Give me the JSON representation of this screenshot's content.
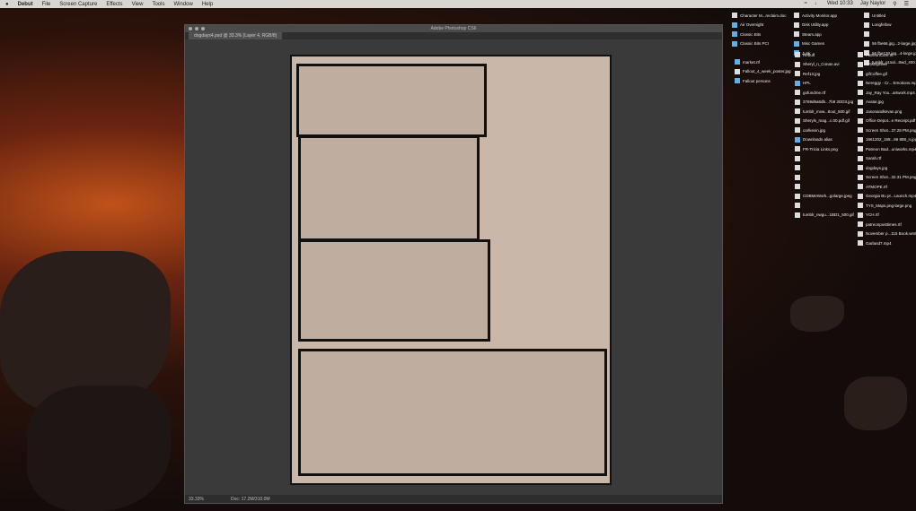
{
  "menubar": {
    "app": "Debut",
    "items": [
      "File",
      "Screen Capture",
      "Effects",
      "View",
      "Tools",
      "Window",
      "Help"
    ],
    "clock": "Wed 10:33",
    "user": "Jay Naylor"
  },
  "window": {
    "title": "Adobe Photoshop CS6",
    "doc_tab": "dogdays4.psd @ 33.3% (Layer 4, RGB/8)",
    "zoom": "33.33%",
    "doc_info": "Doc: 17.2M/310.0M"
  },
  "desktop": {
    "col1": [
      {
        "label": "Character M...reclaim.doc",
        "icon": "file"
      },
      {
        "label": "Air Overnight",
        "icon": "folder"
      },
      {
        "label": "Classic Bits",
        "icon": "folder"
      },
      {
        "label": "Classic Bits PCI",
        "icon": "folder"
      }
    ],
    "col2": [
      {
        "label": "Activity Monitor.app",
        "icon": "app"
      },
      {
        "label": "Disk Utility.app",
        "icon": "app"
      },
      {
        "label": "Steam.app",
        "icon": "app"
      },
      {
        "label": "Misc Games",
        "icon": "folder"
      },
      {
        "label": "Junk",
        "icon": "folder"
      }
    ],
    "col3": [
      {
        "label": "Untitled",
        "icon": "file"
      },
      {
        "label": "Longfellow",
        "icon": "file"
      },
      {
        "label": "",
        "icon": "file"
      },
      {
        "label": "56 fbe66.jpg...2-large.jpg",
        "icon": "file"
      },
      {
        "label": "56 fbe120.jpg...4-large.jpg",
        "icon": "file"
      },
      {
        "label": "tumblr_o1sal...8wd_400.gif",
        "icon": "file"
      }
    ],
    "col4": [
      {
        "label": "market.rtf",
        "icon": "folder"
      },
      {
        "label": "Fallout_4_week_poster.jpg",
        "icon": "file"
      },
      {
        "label": "Fallout persons",
        "icon": "folder"
      }
    ],
    "col5": [
      {
        "label": "Rebuff",
        "icon": "file"
      },
      {
        "label": "Sheryl_n_Conan.avi",
        "icon": "file"
      },
      {
        "label": "Ref13.jpg",
        "icon": "file"
      },
      {
        "label": "HPL",
        "icon": "folder"
      },
      {
        "label": "gofundme.rtf",
        "icon": "file"
      },
      {
        "label": "3769d6a6db...7b8 2DD3.jpg",
        "icon": "file"
      },
      {
        "label": "tumblr_mxw...8out_500.gif",
        "icon": "file"
      },
      {
        "label": "Sheryls_mag...c.00.pdf.gif",
        "icon": "file"
      },
      {
        "label": "carlkevin.jpg",
        "icon": "file"
      },
      {
        "label": "Downloads alias",
        "icon": "folder"
      },
      {
        "label": "FR-Tricia Links.png",
        "icon": "file"
      },
      {
        "label": "",
        "icon": "file"
      },
      {
        "label": "",
        "icon": "file"
      },
      {
        "label": "",
        "icon": "file"
      },
      {
        "label": "",
        "icon": "file"
      },
      {
        "label": "CDBMeWork...golarge.jpeg",
        "icon": "file"
      },
      {
        "label": "",
        "icon": "file"
      },
      {
        "label": "tumblr_nwgu...1BD1_500.gif",
        "icon": "file"
      }
    ],
    "col6": [
      {
        "label": "PatreonCore.rtf",
        "icon": "file"
      },
      {
        "label": "Artistsphere",
        "icon": "file"
      },
      {
        "label": "gifCoffee.gif",
        "icon": "file"
      },
      {
        "label": "Nereggy - Cr... Emotions.mp4",
        "icon": "file"
      },
      {
        "label": "Jay_Ray You...artwork.mp4",
        "icon": "file"
      },
      {
        "label": "Avatar.jpg",
        "icon": "file"
      },
      {
        "label": "Jasonandkevan.png",
        "icon": "file"
      },
      {
        "label": "Office Depot...e Receipt.pdf",
        "icon": "file"
      },
      {
        "label": "Screen Shot...37.28 PM.png",
        "icon": "file"
      },
      {
        "label": "1661202_158...86 888_n.jpg",
        "icon": "file"
      },
      {
        "label": "Patreon Bad...uniworks.mp4",
        "icon": "file"
      },
      {
        "label": "Sarah.rtf",
        "icon": "file"
      },
      {
        "label": "dogdays.jpg",
        "icon": "file"
      },
      {
        "label": "Screen Shot...32.31 PM.png",
        "icon": "file"
      },
      {
        "label": "ATMOPE.rtf",
        "icon": "file"
      },
      {
        "label": "Georgia Bu pr...Launch.mp4",
        "icon": "file"
      },
      {
        "label": "TYS_Maps.png-large.png",
        "icon": "file"
      },
      {
        "label": "YCH.rtf",
        "icon": "file"
      },
      {
        "label": "patreonposttimes.rtf",
        "icon": "file"
      },
      {
        "label": "November p...115 Book.wmf",
        "icon": "file"
      },
      {
        "label": "Garland7.mp4",
        "icon": "file"
      }
    ]
  }
}
